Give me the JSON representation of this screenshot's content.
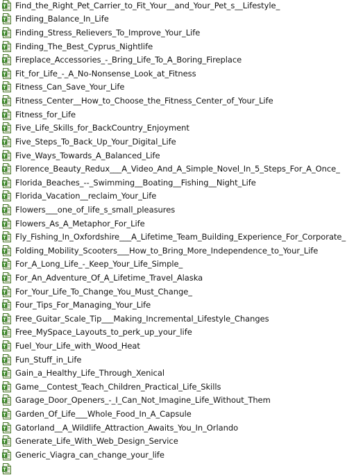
{
  "file_list": {
    "icon": "text-document-icon",
    "items": [
      "Find_the_Right_Pet_Carrier_to_Fit_Your__and_Your_Pet_s__Lifestyle_",
      "Finding_Balance_In_Life",
      "Finding_Stress_Relievers_To_Improve_Your_Life",
      "Finding_The_Best_Cyprus_Nightlife",
      "Fireplace_Accessories_-_Bring_Life_To_A_Boring_Fireplace",
      "Fit_for_Life_-_A_No-Nonsense_Look_at_Fitness",
      "Fitness_Can_Save_Your_Life",
      "Fitness_Center__How_to_Choose_the_Fitness_Center_of_Your_Life",
      "Fitness_for_Life",
      "Five_Life_Skills_for_BackCountry_Enjoyment",
      "Five_Steps_To_Back_Up_Your_Digital_Life",
      "Five_Ways_Towards_A_Balanced_Life",
      "Florence_Beauty_Redux___A_Video_And_A_Simple_Novel_In_5_Steps_For_A_Once_",
      "Florida_Beaches_--_Swimming__Boating__Fishing__Night_Life",
      "Florida_Vacation__reclaim_Your_Life",
      "Flowers___one_of_life_s_small_pleasures",
      "Flowers_As_A_Metaphor_For_Life",
      "Fly_Fishing_In_Oxfordshire___A_Lifetime_Team_Building_Experience_For_Corporate_",
      "Folding_Mobility_Scooters___How_to_Bring_More_Independence_to_Your_Life",
      "For_A_Long_Life_-_Keep_Your_Life_Simple_",
      "For_An_Adventure_Of_A_Lifetime_Travel_Alaska",
      "For_Your_Life_To_Change_You_Must_Change_",
      "Four_Tips_For_Managing_Your_Life",
      "Free_Guitar_Scale_Tip___Making_Incremental_Lifestyle_Changes",
      "Free_MySpace_Layouts_to_perk_up_your_life",
      "Fuel_Your_Life_with_Wood_Heat",
      "Fun_Stuff_in_Life",
      "Gain_a_Healthy_Life_Through_Xenical",
      "Game__Contest_Teach_Children_Practical_Life_Skills",
      "Garage_Door_Openers_-_I_Can_Not_Imagine_Life_Without_Them",
      "Garden_Of_Life___Whole_Food_In_A_Capsule",
      "Gatorland__A_Wildlife_Attraction_Awaits_You_In_Orlando",
      "Generate_Life_With_Web_Design_Service",
      "Generic_Viagra_can_change_your_life",
      ""
    ]
  }
}
